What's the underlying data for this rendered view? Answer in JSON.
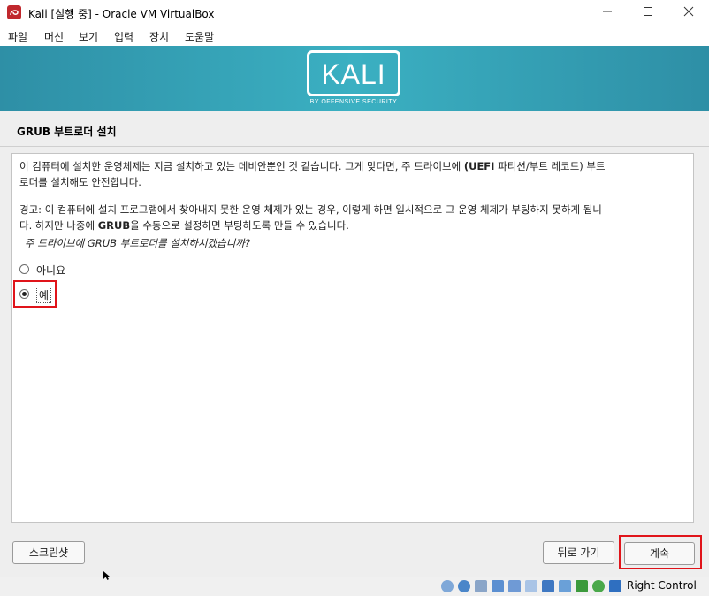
{
  "window": {
    "title": "Kali [실행 중] - Oracle VM VirtualBox"
  },
  "menu": [
    "파일",
    "머신",
    "보기",
    "입력",
    "장치",
    "도움말"
  ],
  "banner": {
    "logo_text": "KALI",
    "logo_sub": "BY OFFENSIVE SECURITY"
  },
  "page": {
    "section_title": "GRUB 부트로더 설치",
    "para1": [
      "이 컴퓨터에 설치한 운영체제는 지금 설치하고 있는 데비안뿐인 것 같습니다. 그게 맞다면, 주 드라이브에 ",
      "(UEFI",
      " 파티션/부트 레코드) 부트",
      "로더를 설치해도 안전합니다."
    ],
    "para2": [
      "경고: 이 컴퓨터에 설치 프로그램에서 찾아내지 못한 운영 체제가 있는 경우, 이렇게 하면 일시적으로 그 운영 체제가 부팅하지 못하게 됩니",
      "다. 하지만 나중에 ",
      "GRUB",
      "을 수동으로 설정하면 부팅하도록 만들 수 있습니다."
    ],
    "question": "주 드라이브에 GRUB 부트로더를 설치하시겠습니까?",
    "options": [
      {
        "label": "아니요",
        "selected": false
      },
      {
        "label": "예",
        "selected": true
      }
    ]
  },
  "buttons": {
    "screenshot": "스크린샷",
    "back": "뒤로 가기",
    "continue": "계속"
  },
  "statusbar": {
    "host_key": "Right Control"
  },
  "colors": {
    "banner": "#3bb0c2",
    "highlight": "#e0141a"
  }
}
